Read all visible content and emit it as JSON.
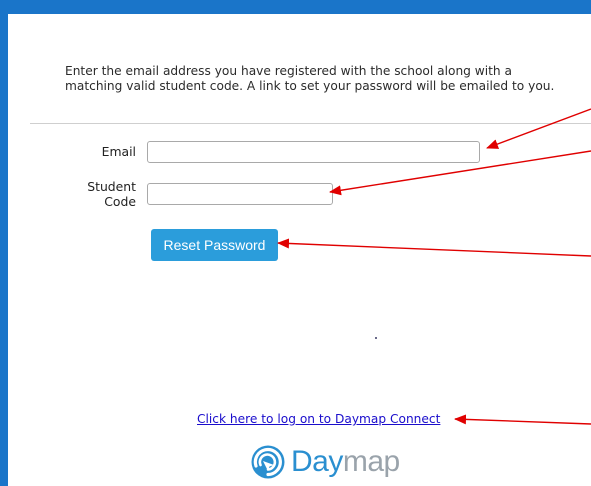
{
  "intro_text": "Enter the email address you have registered with the school along with a matching valid student code. A link to set your password will be emailed to you.",
  "form": {
    "email_label": "Email",
    "email_value": "",
    "student_code_label": "Student Code",
    "student_code_value": "",
    "reset_button_label": "Reset Password"
  },
  "footer": {
    "connect_link_text": "Click here to log on to Daymap Connect",
    "logo_text_day": "Day",
    "logo_text_map": "map"
  },
  "colors": {
    "top_bar": "#1a75c9",
    "button": "#2b9ddb",
    "link": "#1a0dcc",
    "annotation_arrow": "#e00000",
    "logo_blue": "#2a8fd0",
    "logo_gray": "#9aa3ab"
  }
}
